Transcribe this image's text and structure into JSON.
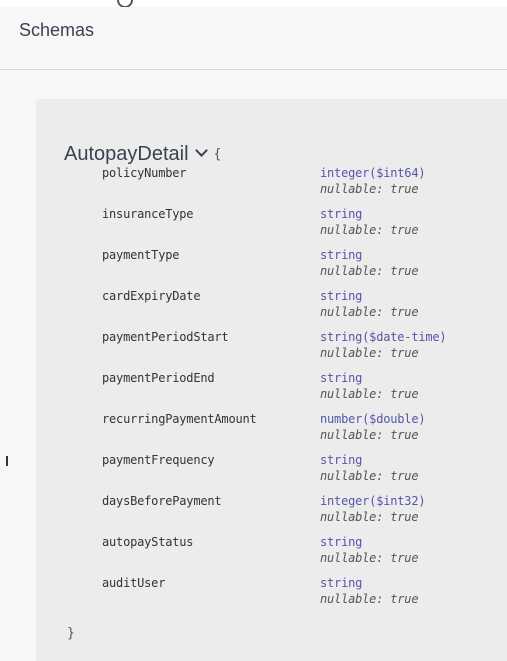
{
  "section": {
    "title": "Schemas"
  },
  "model": {
    "name": "AutopayDetail",
    "open_brace": "{",
    "close_brace": "}",
    "properties": [
      {
        "name": "policyNumber",
        "type": "integer($int64)",
        "nullable": "nullable: true"
      },
      {
        "name": "insuranceType",
        "type": "string",
        "nullable": "nullable: true"
      },
      {
        "name": "paymentType",
        "type": "string",
        "nullable": "nullable: true"
      },
      {
        "name": "cardExpiryDate",
        "type": "string",
        "nullable": "nullable: true"
      },
      {
        "name": "paymentPeriodStart",
        "type": "string($date-time)",
        "nullable": "nullable: true"
      },
      {
        "name": "paymentPeriodEnd",
        "type": "string",
        "nullable": "nullable: true"
      },
      {
        "name": "recurringPaymentAmount",
        "type": "number($double)",
        "nullable": "nullable: true"
      },
      {
        "name": "paymentFrequency",
        "type": "string",
        "nullable": "nullable: true"
      },
      {
        "name": "daysBeforePayment",
        "type": "integer($int32)",
        "nullable": "nullable: true"
      },
      {
        "name": "autopayStatus",
        "type": "string",
        "nullable": "nullable: true"
      },
      {
        "name": "auditUser",
        "type": "string",
        "nullable": "nullable: true"
      }
    ]
  },
  "colors": {
    "type_color": "#55a",
    "title_color": "#3b4151",
    "model_background": "#ececec"
  },
  "icons": {
    "expand": "chevron-down-icon"
  }
}
